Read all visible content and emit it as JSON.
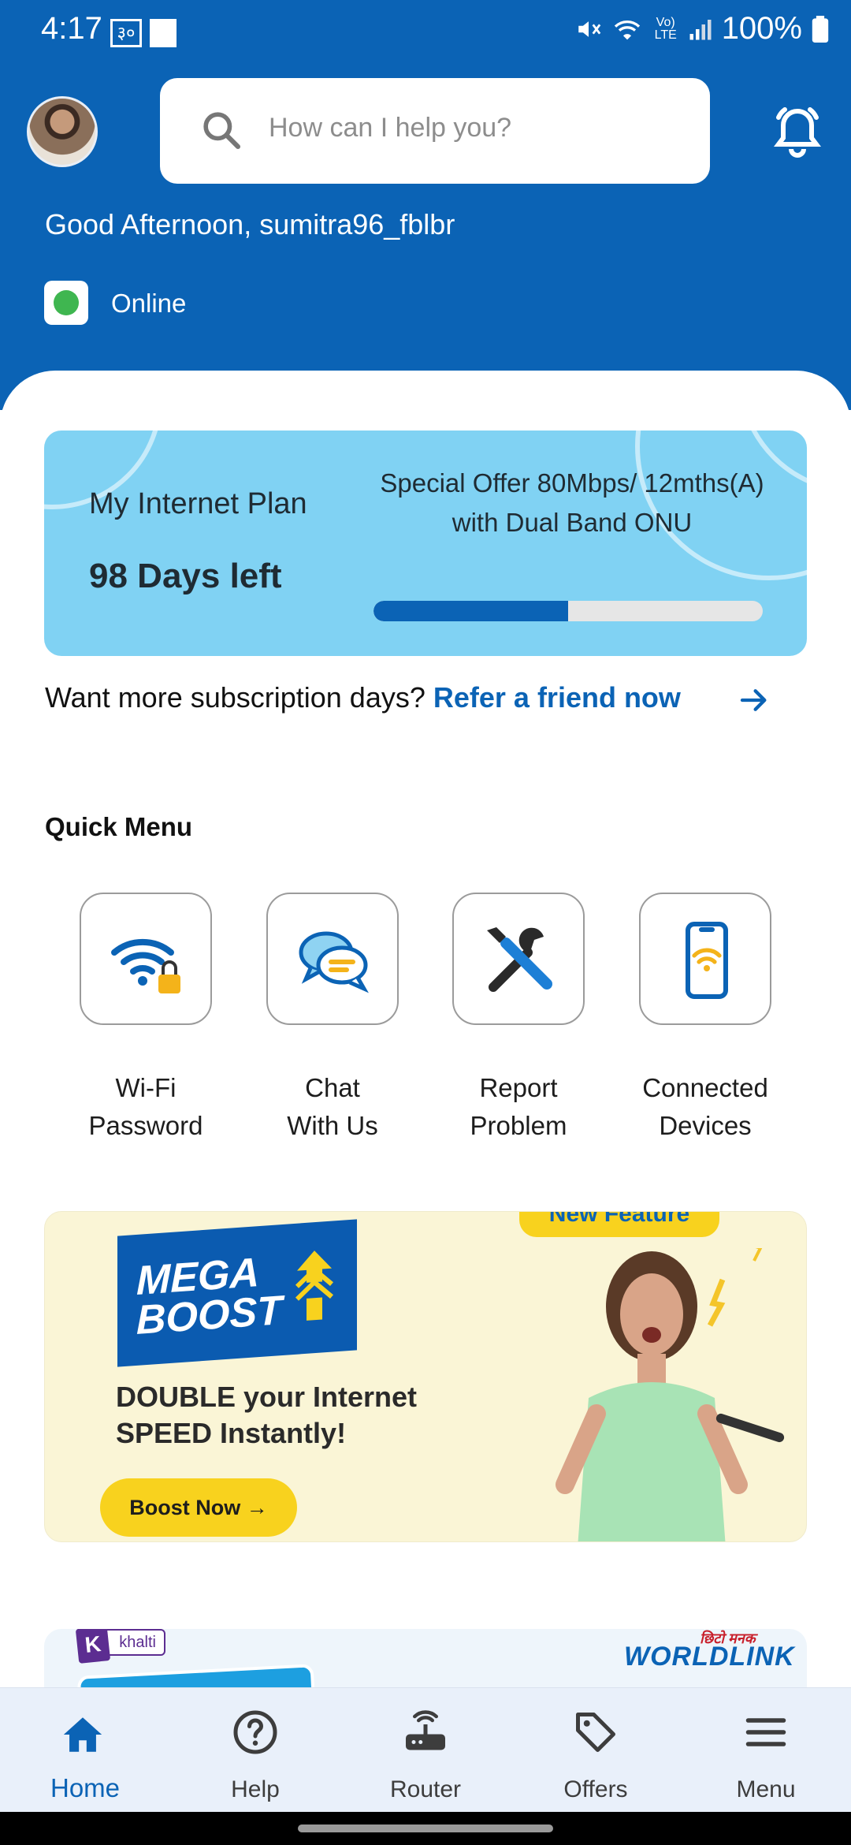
{
  "status_bar": {
    "time": "4:17",
    "indicator_1": "३०",
    "battery": "100%",
    "network_label": "Vo) LTE"
  },
  "header": {
    "search_placeholder": "How can I help you?",
    "greeting": "Good Afternoon, sumitra96_fblbr",
    "connection_status": "Online"
  },
  "plan": {
    "title": "My Internet Plan",
    "days_left": "98 Days left",
    "offer": "Special Offer 80Mbps/ 12mths(A) with Dual Band ONU",
    "progress_fraction": 0.5
  },
  "refer": {
    "prompt": "Want more subscription days? ",
    "link": "Refer a friend now"
  },
  "quick_menu": {
    "title": "Quick Menu",
    "items": [
      {
        "label_line1": "Wi-Fi",
        "label_line2": "Password",
        "icon": "wifi-lock-icon"
      },
      {
        "label_line1": "Chat",
        "label_line2": "With Us",
        "icon": "chat-bubbles-icon"
      },
      {
        "label_line1": "Report",
        "label_line2": "Problem",
        "icon": "tools-icon"
      },
      {
        "label_line1": "Connected",
        "label_line2": "Devices",
        "icon": "phone-wifi-icon"
      }
    ]
  },
  "promo": {
    "badge": "New Feature",
    "brand_line1": "MEGA",
    "brand_line2": "BOOST",
    "headline_line1": "DOUBLE your Internet",
    "headline_line2": "SPEED Instantly!",
    "button": "Boost Now →"
  },
  "banner2": {
    "partner": "khalti",
    "partner_mark": "K",
    "brand_tagline": "छिटो मनक",
    "brand": "WORLDLINK"
  },
  "bottom_nav": {
    "items": [
      {
        "label": "Home",
        "icon": "home-icon",
        "active": true
      },
      {
        "label": "Help",
        "icon": "help-icon",
        "active": false
      },
      {
        "label": "Router",
        "icon": "router-icon",
        "active": false
      },
      {
        "label": "Offers",
        "icon": "tag-icon",
        "active": false
      },
      {
        "label": "Menu",
        "icon": "menu-icon",
        "active": false
      }
    ]
  },
  "colors": {
    "brand_blue": "#0b63b5",
    "plan_card": "#80d2f3",
    "online_green": "#3fb650",
    "promo_yellow": "#f8d21e"
  }
}
